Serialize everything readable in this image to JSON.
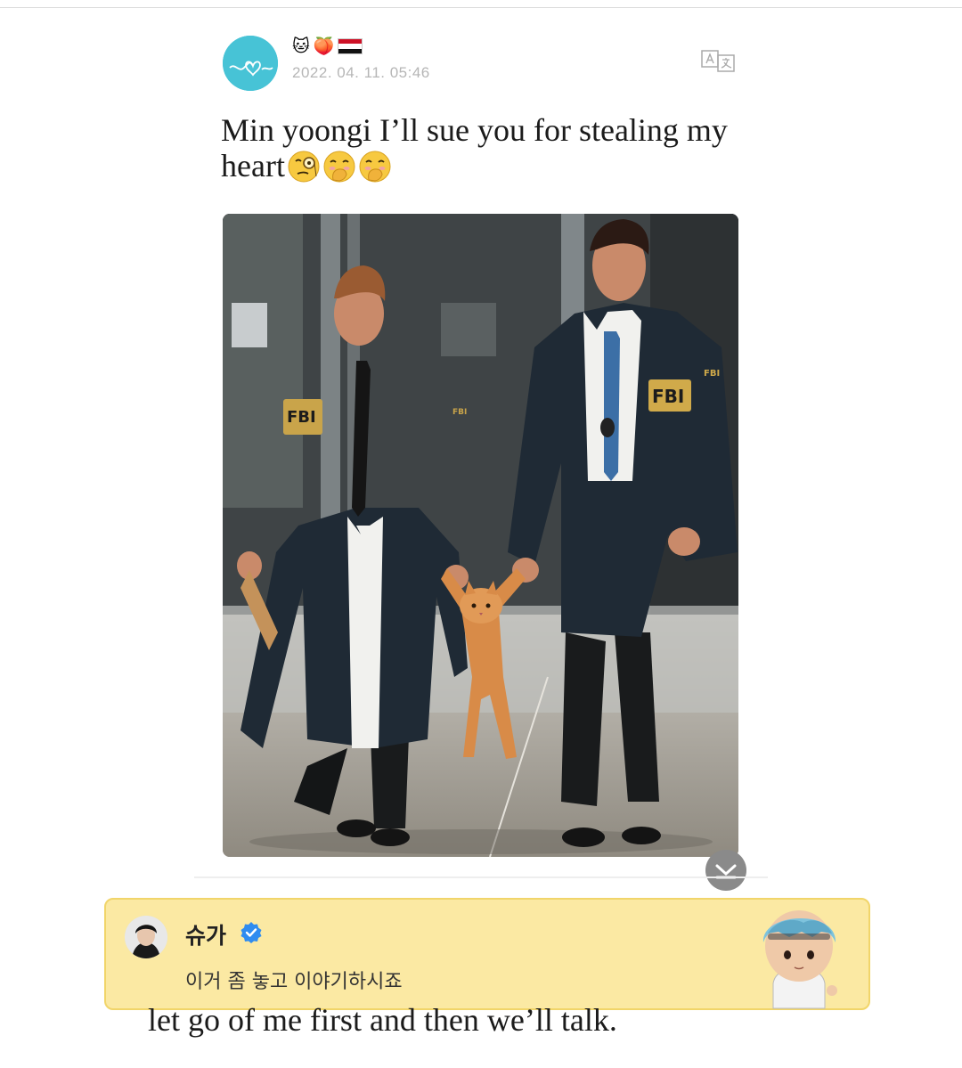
{
  "post": {
    "avatar_icon": "doodle-heart-avatar",
    "badge_emojis": [
      "🐱",
      "🍑"
    ],
    "flag_icon": "egypt-flag-icon",
    "timestamp": "2022. 04. 11. 05:46",
    "translate_icon": "translate-icon",
    "text": "Min yoongi I’ll sue you for stealing my heart",
    "reaction_icons": [
      "monocle-face-icon",
      "hand-over-mouth-icon",
      "hand-over-mouth-icon"
    ],
    "image_text": {
      "badge_left": "FBI",
      "badge_right": "FBI",
      "sleeve_left": "FBI",
      "sleeve_right": "FBI"
    },
    "expand_icon": "chevron-down-icon"
  },
  "reply": {
    "name": "슈가",
    "verified_icon": "verified-check-icon",
    "text": "이거 좀 놓고 이야기하시죠",
    "sticker_icon": "blue-hair-character-sticker"
  },
  "caption": "let go of me first and then we’ll talk.",
  "colors": {
    "card_bg": "#fbe9a3",
    "card_border": "#f1d56a",
    "avatar_bg": "#47c3d6",
    "verified": "#2f8cf0"
  }
}
